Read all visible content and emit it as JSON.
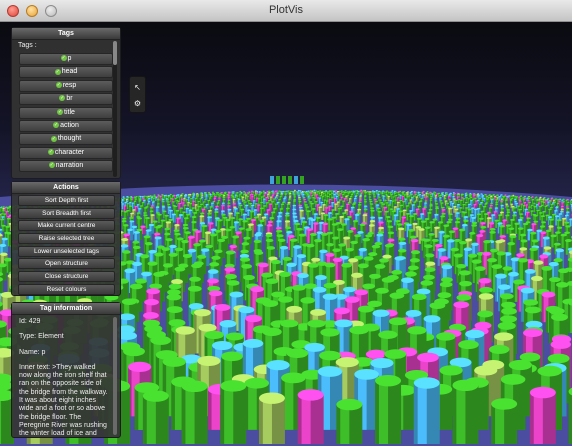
{
  "window": {
    "title": "PlotVis"
  },
  "tags_panel": {
    "header": "Tags",
    "label": "Tags :",
    "items": [
      {
        "label": "p"
      },
      {
        "label": "head"
      },
      {
        "label": "resp"
      },
      {
        "label": "br"
      },
      {
        "label": "title"
      },
      {
        "label": "action"
      },
      {
        "label": "thought"
      },
      {
        "label": "character"
      },
      {
        "label": "narration"
      }
    ]
  },
  "actions_panel": {
    "header": "Actions",
    "buttons": [
      {
        "label": "Sort Depth first"
      },
      {
        "label": "Sort Breadth first"
      },
      {
        "label": "Make current centre"
      },
      {
        "label": "Raise selected tree"
      },
      {
        "label": "Lower unselected tags"
      },
      {
        "label": "Open structure"
      },
      {
        "label": "Close structure"
      },
      {
        "label": "Reset colours"
      }
    ]
  },
  "info_panel": {
    "header": "Tag information",
    "id": "Id: 429",
    "type": "Type: Element",
    "name": "Name: p",
    "inner_text": "Inner text: >They walked now along the iron shelf that ran on the opposite side of the bridge from the walkway. It was about eight inches wide and a foot or so above the bridge floor. The Peregrine River was rushing the winter load of ice and snow, now melted, out into Lake Huron. It was"
  },
  "toolbox": {
    "icons": [
      "cursor-icon",
      "gear-icon"
    ]
  },
  "colors": {
    "green": "#3bb526",
    "blue": "#47b4f0",
    "magenta": "#e040c0",
    "olive": "#9ec25a",
    "panel": "#343434"
  }
}
